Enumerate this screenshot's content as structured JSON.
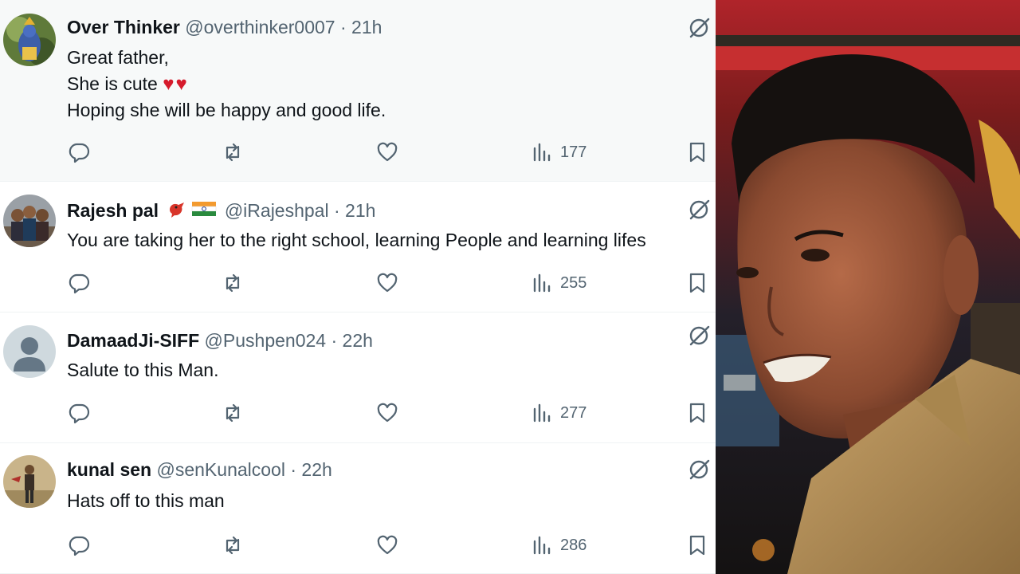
{
  "replies": [
    {
      "name": "Over Thinker",
      "handle": "@overthinker0007",
      "separator": "·",
      "time": "21h",
      "lines": [
        "Great father,",
        "She is cute",
        "Hoping she will be happy and good life."
      ],
      "hearts": "♥♥",
      "views": "177",
      "avatar_icon": "krishna-painting-avatar"
    },
    {
      "name": "Rajesh pal",
      "badges": [
        "bird-emoji",
        "india-flag-emoji"
      ],
      "handle": "@iRajeshpal",
      "separator": "·",
      "time": "21h",
      "lines": [
        "You are taking her to the right school, learning People and learning lifes"
      ],
      "views": "255",
      "avatar_icon": "group-photo-avatar"
    },
    {
      "name": "DamaadJi-SIFF",
      "handle": "@Pushpen024",
      "separator": "·",
      "time": "22h",
      "lines": [
        "Salute to this Man."
      ],
      "views": "277",
      "avatar_icon": "default-person-avatar"
    },
    {
      "name": "kunal sen",
      "handle": "@senKunalcool",
      "separator": "·",
      "time": "22h",
      "lines": [
        "Hats off to this man"
      ],
      "views": "286",
      "avatar_icon": "standing-man-avatar"
    }
  ],
  "icons": {
    "reply": "reply-icon",
    "repost": "repost-icon",
    "like": "heart-icon",
    "views": "views-icon",
    "bookmark": "bookmark-icon",
    "grok": "grok-icon"
  },
  "colors": {
    "text": "#0f1419",
    "secondary": "#536471",
    "heart_emoji": "#d61b2c",
    "highlight_row": "#f7f9f9",
    "divider": "#eff3f4"
  },
  "photo": {
    "description_icon": "auto-rickshaw-driver-photo"
  }
}
